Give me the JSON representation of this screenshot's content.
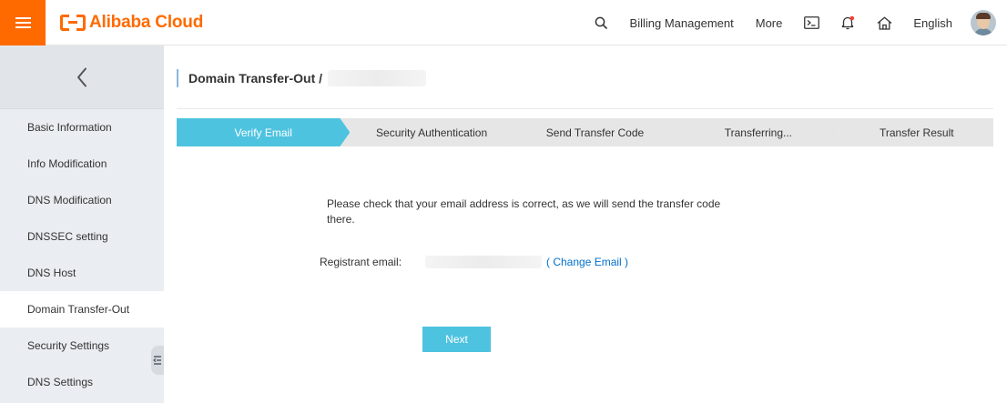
{
  "header": {
    "logo_text": "Alibaba Cloud",
    "billing_label": "Billing Management",
    "more_label": "More",
    "language_label": "English",
    "icons": [
      "menu-icon",
      "search-icon",
      "terminal-icon",
      "bell-icon",
      "home-icon"
    ],
    "brand_color": "#ff6a00",
    "notification_dot_color": "#f04134"
  },
  "sidebar": {
    "items": [
      {
        "label": "Basic Information"
      },
      {
        "label": "Info Modification"
      },
      {
        "label": "DNS Modification"
      },
      {
        "label": "DNSSEC setting"
      },
      {
        "label": "DNS Host"
      },
      {
        "label": "Domain Transfer-Out",
        "active": true
      },
      {
        "label": "Security Settings"
      },
      {
        "label": "DNS Settings"
      }
    ]
  },
  "main": {
    "breadcrumb": "Domain Transfer-Out /",
    "steps": [
      {
        "label": "Verify Email",
        "active": true
      },
      {
        "label": "Security Authentication"
      },
      {
        "label": "Send Transfer Code"
      },
      {
        "label": "Transferring..."
      },
      {
        "label": "Transfer Result"
      }
    ],
    "notice": "Please check that your email address is correct, as we will send the transfer code there.",
    "email_label": "Registrant email:",
    "change_email_label": "( Change Email )",
    "next_label": "Next",
    "accent_color": "#4ec3e0",
    "link_color": "#0070cc"
  }
}
